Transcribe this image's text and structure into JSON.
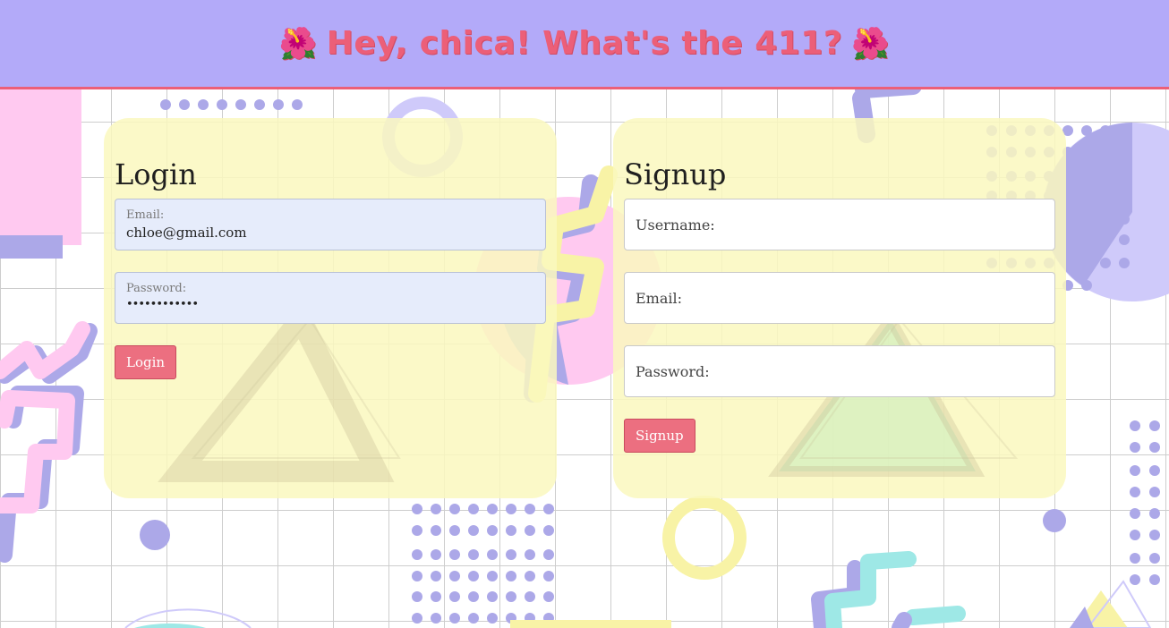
{
  "header": {
    "title": "Hey, chica! What's the 411?",
    "flower_left": "🌺",
    "flower_right": "🌺"
  },
  "login": {
    "heading": "Login",
    "email_label": "Email:",
    "email_value": "chloe@gmail.com",
    "password_label": "Password:",
    "password_value": "••••••••••••",
    "button_label": "Login"
  },
  "signup": {
    "heading": "Signup",
    "username_placeholder": "Username:",
    "email_placeholder": "Email:",
    "password_placeholder": "Password:",
    "button_label": "Signup"
  },
  "colors": {
    "header_bg": "#b3aaf9",
    "accent": "#ec5f78",
    "card_bg": "#faf8be",
    "lavender": "#aca8e8",
    "pink": "#ffcaf0",
    "yellow": "#f8f3a6",
    "teal": "#9ee8e6"
  }
}
